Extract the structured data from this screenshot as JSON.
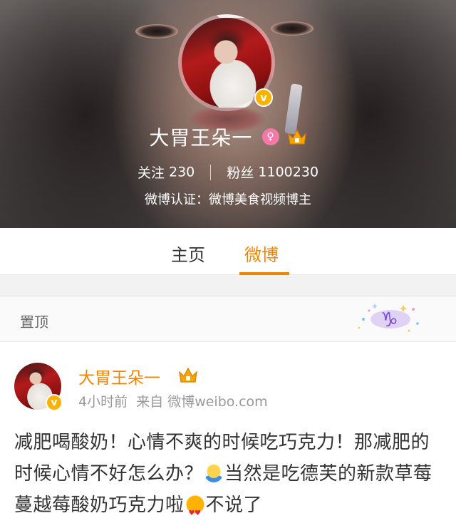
{
  "profile": {
    "name": "大胃王朵一",
    "stats": {
      "following_label": "关注",
      "following_count": "230",
      "followers_label": "粉丝",
      "followers_count": "1100230"
    },
    "verification": "微博认证：微博美食视频博主",
    "badge_letter": "v"
  },
  "tabs": [
    {
      "label": "主页",
      "active": false
    },
    {
      "label": "微博",
      "active": true
    }
  ],
  "pinned": {
    "label": "置顶",
    "icon": "capricorn-zodiac-icon"
  },
  "post": {
    "author": "大胃王朵一",
    "time": "4小时前",
    "source_prefix": "来自",
    "source": "微博weibo.com",
    "text_part1": "减肥喝酸奶！心情不爽的时候吃巧克力！那减肥的时候心情不好怎么办？",
    "text_part2": "当然是吃德芙的新款草莓蔓越莓酸奶巧克力啦",
    "text_part3": "不说了"
  },
  "colors": {
    "accent": "#f08400",
    "verified_badge": "#f7b300",
    "female_icon": "#f27aa6"
  }
}
